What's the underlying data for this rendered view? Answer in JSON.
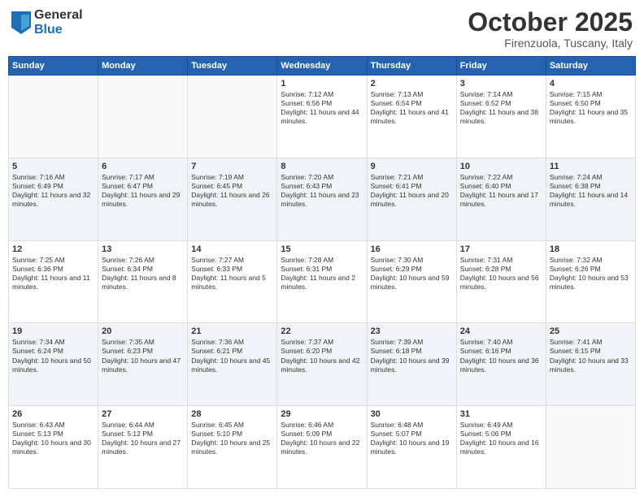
{
  "header": {
    "logo": {
      "general": "General",
      "blue": "Blue"
    },
    "title": "October 2025",
    "location": "Firenzuola, Tuscany, Italy"
  },
  "weekdays": [
    "Sunday",
    "Monday",
    "Tuesday",
    "Wednesday",
    "Thursday",
    "Friday",
    "Saturday"
  ],
  "weeks": [
    [
      null,
      null,
      null,
      {
        "day": 1,
        "sunrise": "7:12 AM",
        "sunset": "6:56 PM",
        "daylight": "11 hours and 44 minutes."
      },
      {
        "day": 2,
        "sunrise": "7:13 AM",
        "sunset": "6:54 PM",
        "daylight": "11 hours and 41 minutes."
      },
      {
        "day": 3,
        "sunrise": "7:14 AM",
        "sunset": "6:52 PM",
        "daylight": "11 hours and 38 minutes."
      },
      {
        "day": 4,
        "sunrise": "7:15 AM",
        "sunset": "6:50 PM",
        "daylight": "11 hours and 35 minutes."
      }
    ],
    [
      {
        "day": 5,
        "sunrise": "7:16 AM",
        "sunset": "6:49 PM",
        "daylight": "11 hours and 32 minutes."
      },
      {
        "day": 6,
        "sunrise": "7:17 AM",
        "sunset": "6:47 PM",
        "daylight": "11 hours and 29 minutes."
      },
      {
        "day": 7,
        "sunrise": "7:19 AM",
        "sunset": "6:45 PM",
        "daylight": "11 hours and 26 minutes."
      },
      {
        "day": 8,
        "sunrise": "7:20 AM",
        "sunset": "6:43 PM",
        "daylight": "11 hours and 23 minutes."
      },
      {
        "day": 9,
        "sunrise": "7:21 AM",
        "sunset": "6:41 PM",
        "daylight": "11 hours and 20 minutes."
      },
      {
        "day": 10,
        "sunrise": "7:22 AM",
        "sunset": "6:40 PM",
        "daylight": "11 hours and 17 minutes."
      },
      {
        "day": 11,
        "sunrise": "7:24 AM",
        "sunset": "6:38 PM",
        "daylight": "11 hours and 14 minutes."
      }
    ],
    [
      {
        "day": 12,
        "sunrise": "7:25 AM",
        "sunset": "6:36 PM",
        "daylight": "11 hours and 11 minutes."
      },
      {
        "day": 13,
        "sunrise": "7:26 AM",
        "sunset": "6:34 PM",
        "daylight": "11 hours and 8 minutes."
      },
      {
        "day": 14,
        "sunrise": "7:27 AM",
        "sunset": "6:33 PM",
        "daylight": "11 hours and 5 minutes."
      },
      {
        "day": 15,
        "sunrise": "7:28 AM",
        "sunset": "6:31 PM",
        "daylight": "11 hours and 2 minutes."
      },
      {
        "day": 16,
        "sunrise": "7:30 AM",
        "sunset": "6:29 PM",
        "daylight": "10 hours and 59 minutes."
      },
      {
        "day": 17,
        "sunrise": "7:31 AM",
        "sunset": "6:28 PM",
        "daylight": "10 hours and 56 minutes."
      },
      {
        "day": 18,
        "sunrise": "7:32 AM",
        "sunset": "6:26 PM",
        "daylight": "10 hours and 53 minutes."
      }
    ],
    [
      {
        "day": 19,
        "sunrise": "7:34 AM",
        "sunset": "6:24 PM",
        "daylight": "10 hours and 50 minutes."
      },
      {
        "day": 20,
        "sunrise": "7:35 AM",
        "sunset": "6:23 PM",
        "daylight": "10 hours and 47 minutes."
      },
      {
        "day": 21,
        "sunrise": "7:36 AM",
        "sunset": "6:21 PM",
        "daylight": "10 hours and 45 minutes."
      },
      {
        "day": 22,
        "sunrise": "7:37 AM",
        "sunset": "6:20 PM",
        "daylight": "10 hours and 42 minutes."
      },
      {
        "day": 23,
        "sunrise": "7:39 AM",
        "sunset": "6:18 PM",
        "daylight": "10 hours and 39 minutes."
      },
      {
        "day": 24,
        "sunrise": "7:40 AM",
        "sunset": "6:16 PM",
        "daylight": "10 hours and 36 minutes."
      },
      {
        "day": 25,
        "sunrise": "7:41 AM",
        "sunset": "6:15 PM",
        "daylight": "10 hours and 33 minutes."
      }
    ],
    [
      {
        "day": 26,
        "sunrise": "6:43 AM",
        "sunset": "5:13 PM",
        "daylight": "10 hours and 30 minutes."
      },
      {
        "day": 27,
        "sunrise": "6:44 AM",
        "sunset": "5:12 PM",
        "daylight": "10 hours and 27 minutes."
      },
      {
        "day": 28,
        "sunrise": "6:45 AM",
        "sunset": "5:10 PM",
        "daylight": "10 hours and 25 minutes."
      },
      {
        "day": 29,
        "sunrise": "6:46 AM",
        "sunset": "5:09 PM",
        "daylight": "10 hours and 22 minutes."
      },
      {
        "day": 30,
        "sunrise": "6:48 AM",
        "sunset": "5:07 PM",
        "daylight": "10 hours and 19 minutes."
      },
      {
        "day": 31,
        "sunrise": "6:49 AM",
        "sunset": "5:06 PM",
        "daylight": "10 hours and 16 minutes."
      },
      null
    ]
  ]
}
